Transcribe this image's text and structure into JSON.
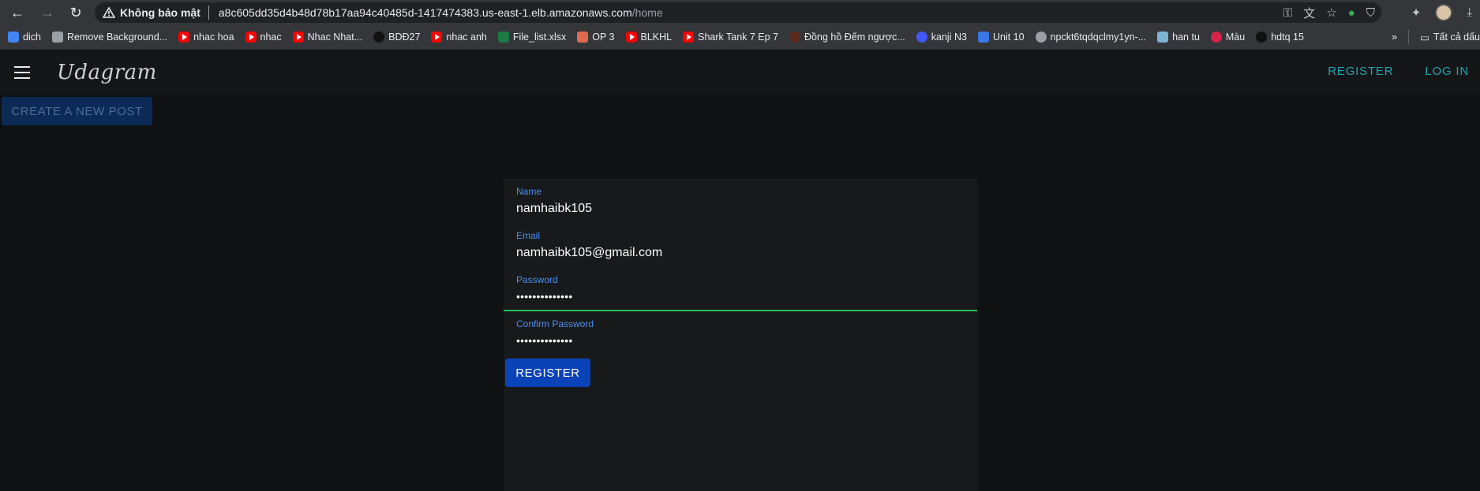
{
  "browser": {
    "security_label": "Không bảo mật",
    "url_host": "a8c605dd35d4b48d78b17aa94c40485d-1417474383.us-east-1.elb.amazonaws.com",
    "url_path": "/home",
    "other_bookmarks_label": "Tất cả dấu"
  },
  "bookmarks": [
    {
      "label": "dich",
      "icon": "translate-icon",
      "color": "#4285f4"
    },
    {
      "label": "Remove Background...",
      "icon": "layers-icon",
      "color": "#9aa0a6"
    },
    {
      "label": "nhac hoa",
      "icon": "youtube-icon",
      "color": "#ff0000"
    },
    {
      "label": "nhac",
      "icon": "youtube-icon",
      "color": "#ff0000"
    },
    {
      "label": "Nhac Nhat...",
      "icon": "youtube-icon",
      "color": "#ff0000"
    },
    {
      "label": "BDĐ27",
      "icon": "tiktok-icon",
      "color": "#111111"
    },
    {
      "label": "nhac anh",
      "icon": "youtube-icon",
      "color": "#ff0000"
    },
    {
      "label": "File_list.xlsx",
      "icon": "excel-icon",
      "color": "#1d7a45"
    },
    {
      "label": "OP 3",
      "icon": "page-icon",
      "color": "#e06a4e"
    },
    {
      "label": "BLKHL",
      "icon": "youtube-icon",
      "color": "#ff0000"
    },
    {
      "label": "Shark Tank 7 Ep 7",
      "icon": "youtube-icon",
      "color": "#ff0000"
    },
    {
      "label": "Đồng hồ Đếm ngược...",
      "icon": "clock-icon",
      "color": "#5a2a1a"
    },
    {
      "label": "kanji N3",
      "icon": "quizlet-icon",
      "color": "#4257ff"
    },
    {
      "label": "Unit 10",
      "icon": "app-icon",
      "color": "#3b78e7"
    },
    {
      "label": "npckt6tqdqclmy1yn-...",
      "icon": "globe-icon",
      "color": "#9aa0a6"
    },
    {
      "label": "han tu",
      "icon": "image-icon",
      "color": "#7fb3d5"
    },
    {
      "label": "Màu",
      "icon": "brush-icon",
      "color": "#d6244b"
    },
    {
      "label": "hdtq 15",
      "icon": "tiktok-icon",
      "color": "#111111"
    }
  ],
  "app": {
    "brand": "Udagram",
    "nav": {
      "register": "REGISTER",
      "login": "LOG IN"
    },
    "create_post": "CREATE A NEW POST",
    "accent": "#1fa6b8"
  },
  "form": {
    "name_label": "Name",
    "name_value": "namhaibk105",
    "email_label": "Email",
    "email_value": "namhaibk105@gmail.com",
    "password_label": "Password",
    "password_value": "••••••••••••••",
    "confirm_label": "Confirm Password",
    "confirm_value": "••••••••••••••",
    "submit": "REGISTER"
  }
}
